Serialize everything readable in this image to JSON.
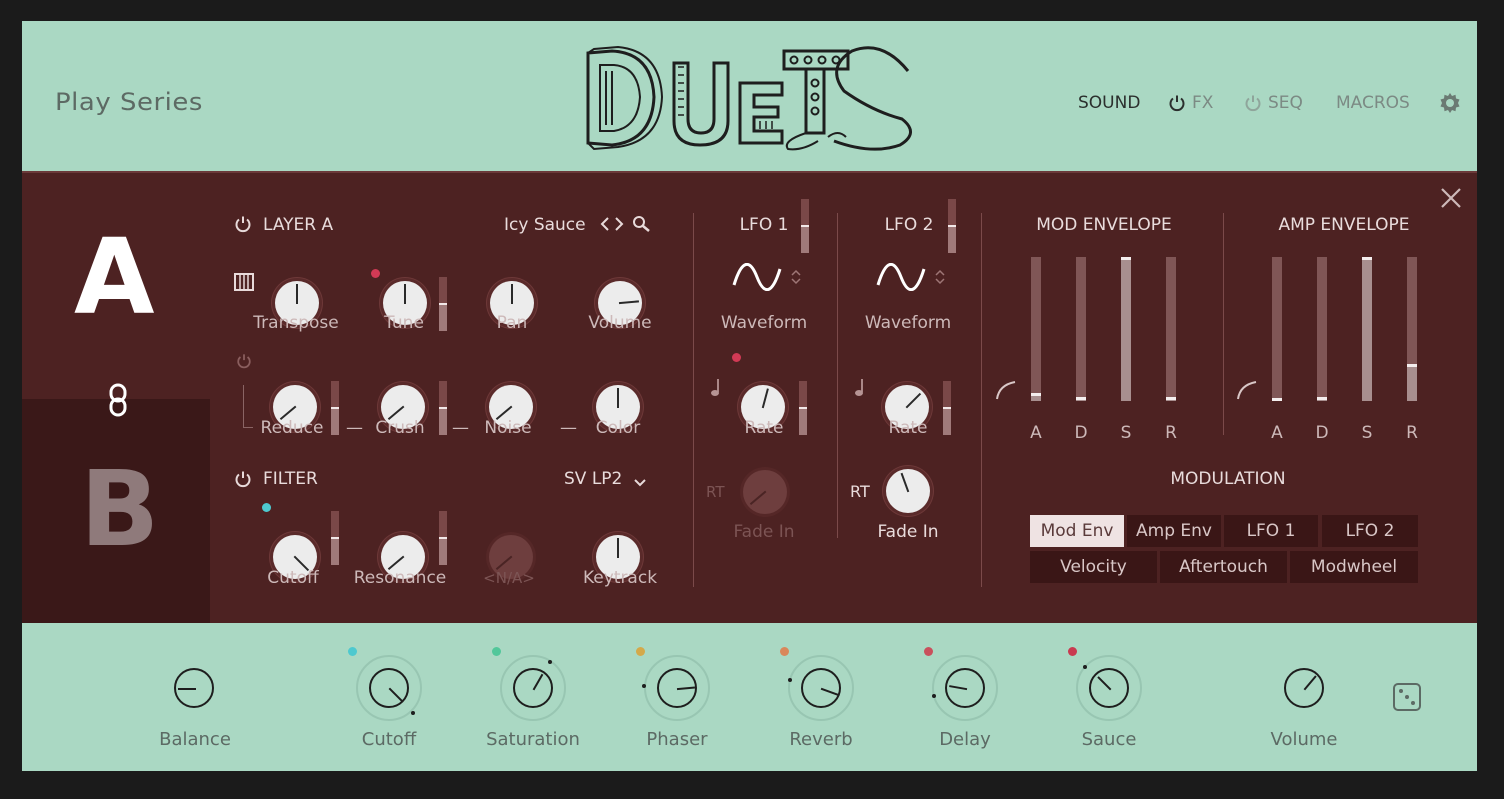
{
  "header": {
    "series": "Play Series",
    "logo_text": "DUETS",
    "nav": [
      {
        "label": "SOUND",
        "active": true
      },
      {
        "label": "FX",
        "active": false
      },
      {
        "label": "SEQ",
        "active": false
      },
      {
        "label": "MACROS",
        "active": false
      }
    ]
  },
  "layers": {
    "a": "A",
    "b": "B"
  },
  "layer_a": {
    "title": "LAYER A",
    "preset": "Icy Sauce",
    "row1": [
      "Transpose",
      "Tune",
      "Pan",
      "Volume"
    ],
    "row2": [
      "Reduce",
      "Crush",
      "Noise",
      "Color"
    ]
  },
  "filter": {
    "title": "FILTER",
    "type": "SV LP2",
    "knobs": [
      "Cutoff",
      "Resonance",
      "<N/A>",
      "Keytrack"
    ]
  },
  "lfo1": {
    "title": "LFO 1",
    "waveform": "Waveform",
    "rate": "Rate",
    "rt": "RT",
    "fade": "Fade In"
  },
  "lfo2": {
    "title": "LFO 2",
    "waveform": "Waveform",
    "rate": "Rate",
    "rt": "RT",
    "fade": "Fade In"
  },
  "mod_env": {
    "title": "MOD ENVELOPE",
    "labels": [
      "A",
      "D",
      "S",
      "R"
    ],
    "levels": [
      0.05,
      0.02,
      1.0,
      0.02
    ]
  },
  "amp_env": {
    "title": "AMP ENVELOPE",
    "labels": [
      "A",
      "D",
      "S",
      "R"
    ],
    "levels": [
      0.0,
      0.02,
      1.0,
      0.25
    ]
  },
  "modulation": {
    "title": "MODULATION",
    "row1": [
      "Mod Env",
      "Amp Env",
      "LFO 1",
      "LFO 2"
    ],
    "row2": [
      "Velocity",
      "Aftertouch",
      "Modwheel"
    ],
    "selected": "Mod Env"
  },
  "footer": {
    "knobs": [
      "Balance",
      "Cutoff",
      "Saturation",
      "Phaser",
      "Reverb",
      "Delay",
      "Sauce",
      "Volume"
    ]
  },
  "colors": {
    "mint": "#aad8c3",
    "panel": "#4d2222",
    "panel_dark": "#3a1818",
    "cyan_dot": "#4ec9cf",
    "red_dot": "#d23a55",
    "green_dot": "#52c79a",
    "yellow_dot": "#d4a94a",
    "orange_dot": "#d9875a",
    "rose_dot": "#c9505c",
    "crimson_dot": "#c93a50"
  }
}
